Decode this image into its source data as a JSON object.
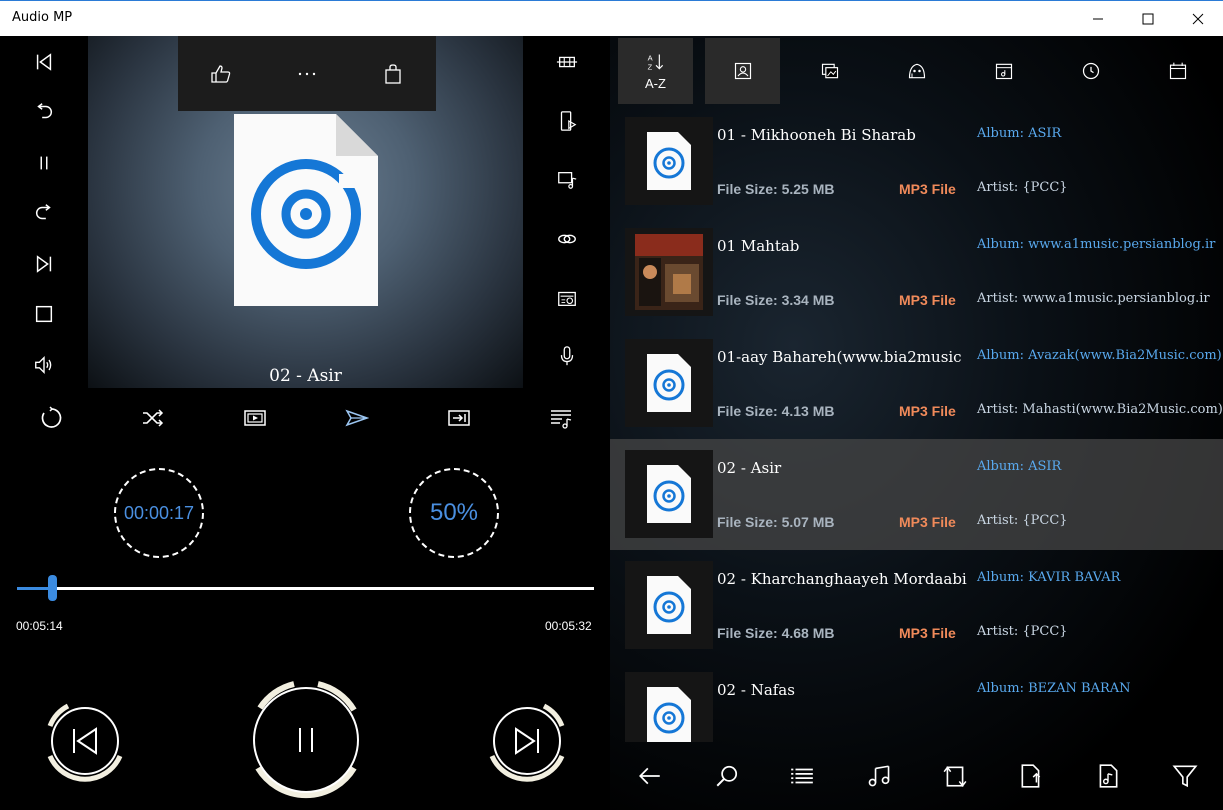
{
  "window": {
    "title": "Audio MP"
  },
  "player": {
    "now_playing": "02 - Asir",
    "elapsed_display": "00:00:17",
    "volume_display": "50%",
    "current_time": "00:05:14",
    "total_time": "00:05:32",
    "seek_fraction": 0.06
  },
  "sort_tab": {
    "label": "A-Z"
  },
  "tracks": [
    {
      "name": "01 - Mikhooneh Bi Sharab",
      "size": "File Size: 5.25 MB",
      "type": "MP3 File",
      "album": "Album: ASIR",
      "artist": "Artist: {PCC}"
    },
    {
      "name": "01 Mahtab",
      "size": "File Size: 3.34 MB",
      "type": "MP3 File",
      "album": "Album: www.a1music.persianblog.ir",
      "artist": "Artist: www.a1music.persianblog.ir"
    },
    {
      "name": "01-aay Bahareh(www.bia2music",
      "size": "File Size: 4.13 MB",
      "type": "MP3 File",
      "album": "Album: Avazak(www.Bia2Music.com)",
      "artist": "Artist: Mahasti(www.Bia2Music.com)"
    },
    {
      "name": "02 - Asir",
      "size": "File Size: 5.07 MB",
      "type": "MP3 File",
      "album": "Album: ASIR",
      "artist": "Artist: {PCC}"
    },
    {
      "name": "02 - Kharchanghaayeh Mordaabi",
      "size": "File Size: 4.68 MB",
      "type": "MP3 File",
      "album": "Album: KAVIR BAVAR",
      "artist": "Artist: {PCC}"
    },
    {
      "name": "02 - Nafas",
      "size": "",
      "type": "",
      "album": "Album: BEZAN BARAN",
      "artist": ""
    }
  ],
  "colors": {
    "accent": "#3b8be0",
    "file_type": "#f08a5a",
    "album_text": "#59a9ee",
    "selected_row": "#464646"
  }
}
